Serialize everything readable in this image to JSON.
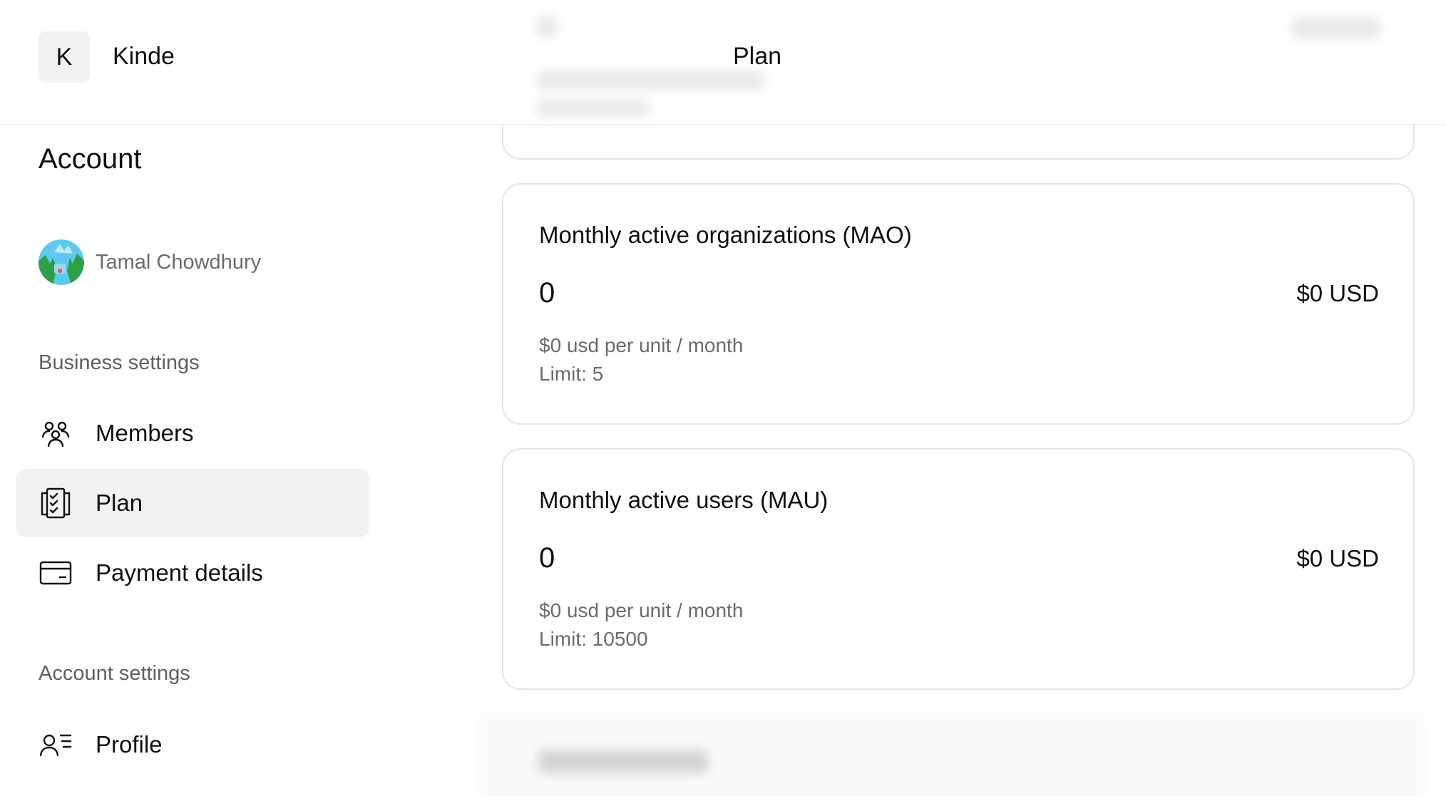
{
  "header": {
    "logo_letter": "K",
    "brand_name": "Kinde",
    "page_title": "Plan"
  },
  "sidebar": {
    "title": "Account",
    "user": {
      "name": "Tamal Chowdhury"
    },
    "business_settings_label": "Business settings",
    "business_items": [
      {
        "label": "Members",
        "icon": "members-icon",
        "active": false
      },
      {
        "label": "Plan",
        "icon": "plan-icon",
        "active": true
      },
      {
        "label": "Payment details",
        "icon": "credit-card-icon",
        "active": false
      }
    ],
    "account_settings_label": "Account settings",
    "account_items": [
      {
        "label": "Profile",
        "icon": "profile-icon",
        "active": false
      }
    ]
  },
  "cards": [
    {
      "title": "Monthly active organizations (MAO)",
      "count": "0",
      "price": "$0  USD",
      "unit_price": "$0  usd per unit / month",
      "limit": "Limit: 5"
    },
    {
      "title": "Monthly active users (MAU)",
      "count": "0",
      "price": "$0  USD",
      "unit_price": "$0  usd per unit / month",
      "limit": "Limit: 10500"
    }
  ],
  "colors": {
    "active_nav_bg": "#f2f2f2",
    "card_border": "#e4e4e4",
    "muted_text": "#6b6b6b"
  }
}
